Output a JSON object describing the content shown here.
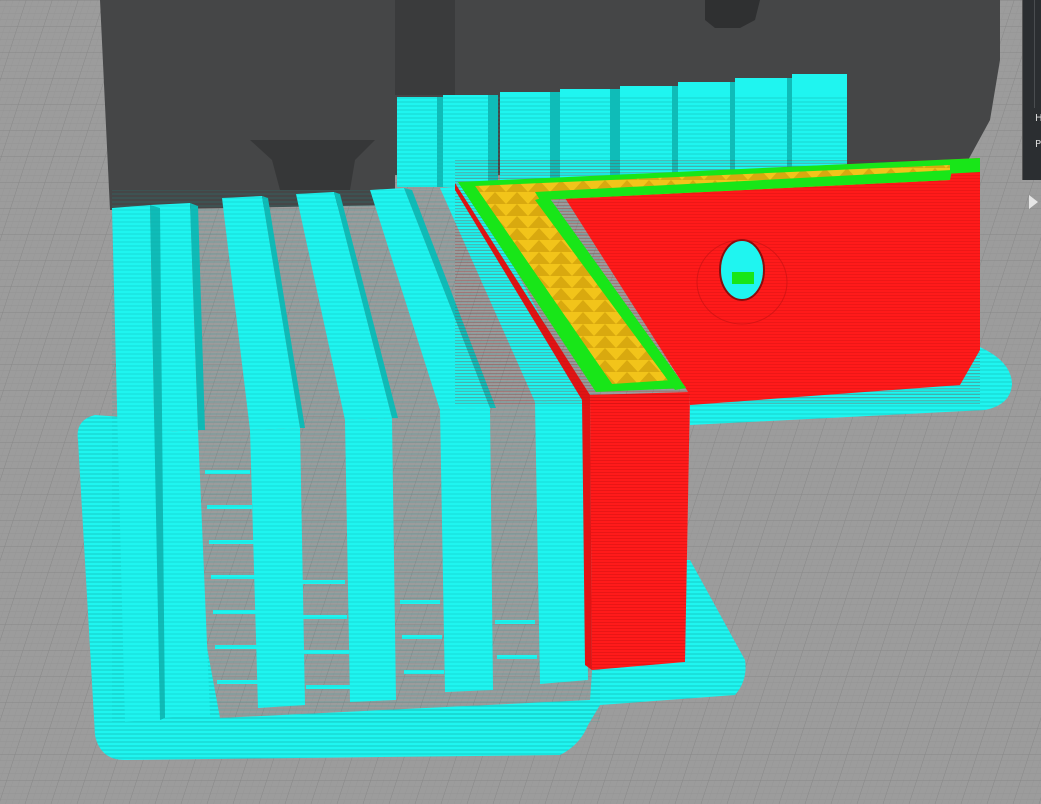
{
  "scene": {
    "description_colors": {
      "bed": "#9a9a9a",
      "bed_grid": "#8a8a8a",
      "shadow_backdrop": "#454647",
      "support": "#1ff5f0",
      "support_dark": "#0fbcb8",
      "support_lines": "#0a8a87",
      "wall": "#ff1a1a",
      "wall_dark": "#c81010",
      "top_perimeter": "#18e618",
      "infill": "#f2c41a"
    },
    "icons": [
      "chevron-right-icon"
    ]
  },
  "side_panel": {
    "letter_h": "H",
    "letter_p": "P"
  }
}
